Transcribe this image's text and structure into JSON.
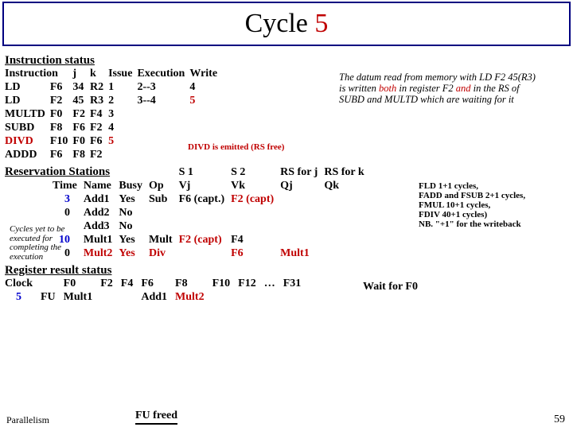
{
  "title": {
    "prefix": "Cycle ",
    "num": "5"
  },
  "section_instruction_status": "Instruction status",
  "inst_header": {
    "c0": "Instruction",
    "c1": "j",
    "c2": "k",
    "c3": "Issue",
    "c4": "Execution",
    "c5": "Write"
  },
  "inst_rows": [
    {
      "op": "LD",
      "dst": "F6",
      "j": "34",
      "k": "R2",
      "issue": "1",
      "exec": "2--3",
      "write": "4"
    },
    {
      "op": "LD",
      "dst": "F2",
      "j": "45",
      "k": "R3",
      "issue": "2",
      "exec": "3--4",
      "write": "5"
    },
    {
      "op": "MULTD",
      "dst": "F0",
      "j": "F2",
      "k": "F4",
      "issue": "3",
      "exec": "",
      "write": ""
    },
    {
      "op": "SUBD",
      "dst": "F8",
      "j": "F6",
      "k": "F2",
      "issue": "4",
      "exec": "",
      "write": ""
    },
    {
      "op": "DIVD",
      "dst": "F10",
      "j": "F0",
      "k": "F6",
      "issue": "5",
      "exec": "",
      "write": ""
    },
    {
      "op": "ADDD",
      "dst": "F6",
      "j": "F8",
      "k": "F2",
      "issue": "",
      "exec": "",
      "write": ""
    }
  ],
  "divd_emitted": "DIVD is emitted (RS free)",
  "note_right": {
    "l1": "The datum read from memory with LD F2 45(R3)",
    "l2a": "is written ",
    "l2b": "both",
    "l2c": " in register F2 ",
    "l2d": "and",
    "l2e": " in the  RS of",
    "l3": "SUBD and MULTD which are waiting for it"
  },
  "section_rs": "Reservation Stations",
  "rs_extra": {
    "s1": "S 1",
    "s2": "S 2",
    "rsforj": "RS for j",
    "rsfork": "RS for k"
  },
  "rs_header": {
    "time": "Time",
    "name": "Name",
    "busy": "Busy",
    "op": "Op",
    "vj": "Vj",
    "vk": "Vk",
    "qj": "Qj",
    "qk": "Qk"
  },
  "rs_rows": [
    {
      "time": "3",
      "name": "Add1",
      "busy": "Yes",
      "op": "Sub",
      "vj": "F6 (capt.)",
      "vk": "F2 (capt)",
      "qj": "",
      "qk": ""
    },
    {
      "time": "0",
      "name": "Add2",
      "busy": "No",
      "op": "",
      "vj": "",
      "vk": "",
      "qj": "",
      "qk": ""
    },
    {
      "time": "",
      "name": "Add3",
      "busy": "No",
      "op": "",
      "vj": "",
      "vk": "",
      "qj": "",
      "qk": ""
    },
    {
      "time": "10",
      "name": "Mult1",
      "busy": "Yes",
      "op": "Mult",
      "vj": "F2 (capt)",
      "vk": "F4",
      "qj": "",
      "qk": ""
    },
    {
      "time": "0",
      "name": "Mult2",
      "busy": "Yes",
      "op": "Div",
      "vj": "",
      "vk": "F6",
      "qj": "Mult1",
      "qk": ""
    }
  ],
  "cycles_note": "Cycles yet to be executed for completing the execution",
  "wait_f0": "Wait for F0",
  "note_rs": {
    "l1": "FLD 1+1 cycles,",
    "l2": "FADD and FSUB 2+1 cycles,",
    "l3": "FMUL 10+1 cycles,",
    "l4": "FDIV 40+1 cycles)",
    "l5": "NB. \"+1\" for the writeback"
  },
  "section_regresult": "Register result status",
  "reg_header": {
    "clock": "Clock",
    "fu": "FU"
  },
  "reg_clock": "5",
  "reg_cols": [
    "F0",
    "F2",
    "F4",
    "F6",
    "F8",
    "F10",
    "F12",
    "…",
    "F31"
  ],
  "reg_vals": [
    "Mult1",
    "",
    "",
    "Add1",
    "Mult2",
    "",
    "",
    "",
    ""
  ],
  "footer_left": "Parallelism",
  "fu_freed": "FU freed",
  "footer_right": "59"
}
